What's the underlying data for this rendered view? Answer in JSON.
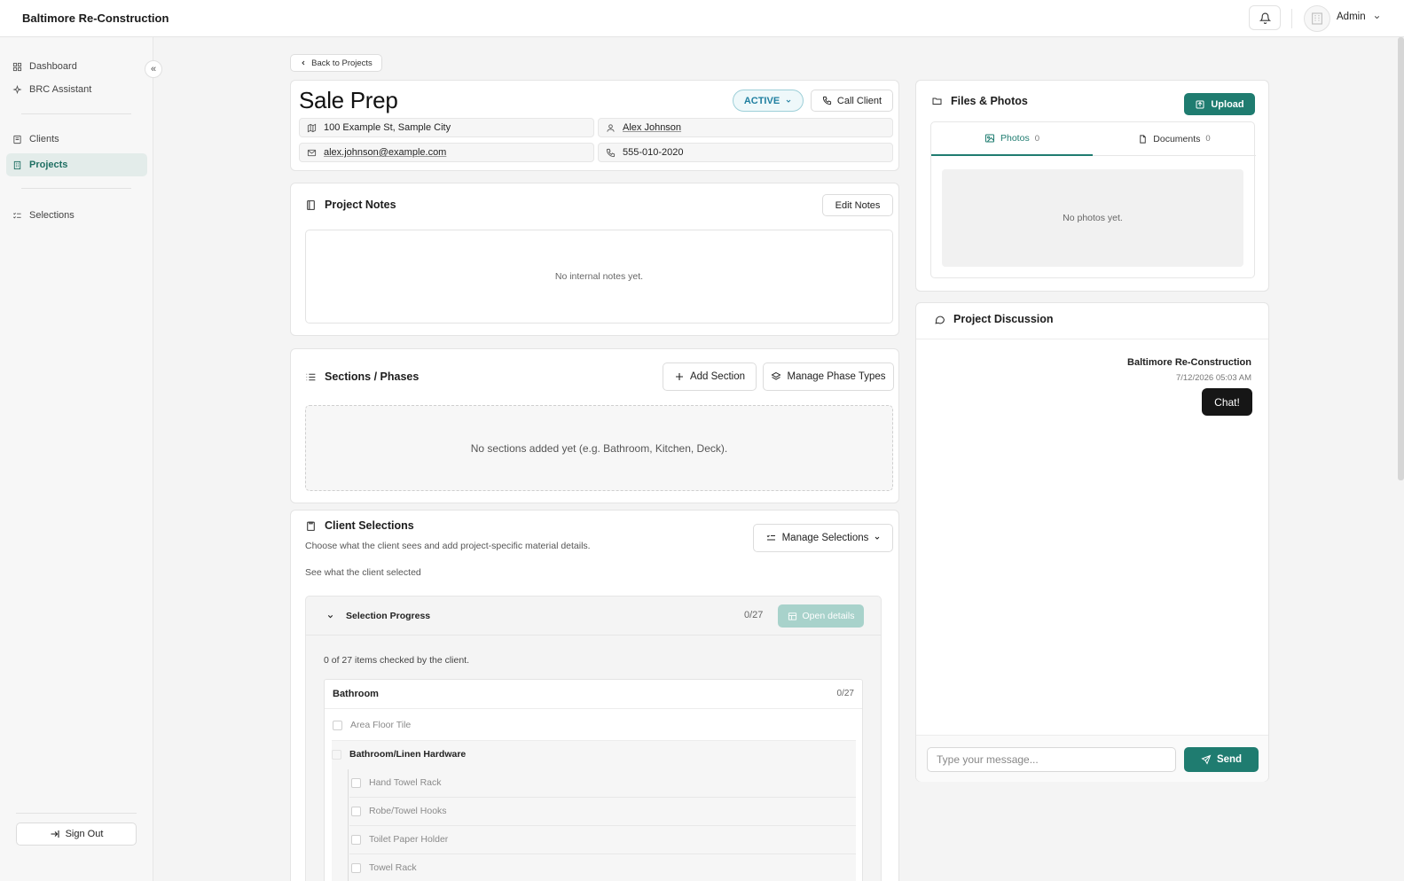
{
  "app": {
    "brand": "Baltimore Re-Construction",
    "user": "Admin"
  },
  "sidebar": {
    "items": [
      {
        "label": "Dashboard",
        "icon": "grid-icon"
      },
      {
        "label": "BRC Assistant",
        "icon": "sparkle-icon"
      },
      {
        "label": "Clients",
        "icon": "book-icon"
      },
      {
        "label": "Projects",
        "icon": "building-icon",
        "active": true
      },
      {
        "label": "Selections",
        "icon": "list-check-icon"
      }
    ],
    "collapse_glyph": "«",
    "sign_out": "Sign Out"
  },
  "project": {
    "back_label": "Back to Projects",
    "title": "Sale Prep",
    "status": "ACTIVE",
    "call_label": "Call Client",
    "address": "100 Example St, Sample City",
    "client_name": "Alex Johnson",
    "email": "alex.johnson@example.com",
    "phone": "555-010-2020"
  },
  "notes": {
    "title": "Project Notes",
    "edit_label": "Edit Notes",
    "empty": "No internal notes yet."
  },
  "sections": {
    "title": "Sections / Phases",
    "add_label": "Add Section",
    "manage_label": "Manage Phase Types",
    "empty": "No sections added yet (e.g. Bathroom, Kitchen, Deck)."
  },
  "selections": {
    "title": "Client Selections",
    "subtitle": "Choose what the client sees and add project-specific material details.",
    "manage_label": "Manage Selections",
    "see_label": "See what the client selected",
    "progress_label": "Selection Progress",
    "progress_count": "0/27",
    "open_details": "Open details",
    "checked_summary": "0 of 27 items checked by the client.",
    "group": {
      "name": "Bathroom",
      "count": "0/27"
    },
    "items": [
      {
        "label": "Area Floor Tile"
      },
      {
        "label": "Bathroom/Linen Hardware"
      },
      {
        "label": "Hand Towel Rack"
      },
      {
        "label": "Robe/Towel Hooks"
      },
      {
        "label": "Toilet Paper Holder"
      },
      {
        "label": "Towel Rack"
      }
    ]
  },
  "files": {
    "title": "Files & Photos",
    "upload_label": "Upload",
    "tabs": [
      {
        "label": "Photos",
        "count": "0",
        "active": true
      },
      {
        "label": "Documents",
        "count": "0"
      }
    ],
    "empty": "No photos yet."
  },
  "discussion": {
    "title": "Project Discussion",
    "messages": [
      {
        "author": "Baltimore Re-Construction",
        "time": "7/12/2026 05:03 AM",
        "text": "Chat!"
      }
    ],
    "input_placeholder": "Type your message...",
    "send_label": "Send"
  },
  "colors": {
    "accent": "#1f7c70",
    "status": "#1f7fa0"
  }
}
